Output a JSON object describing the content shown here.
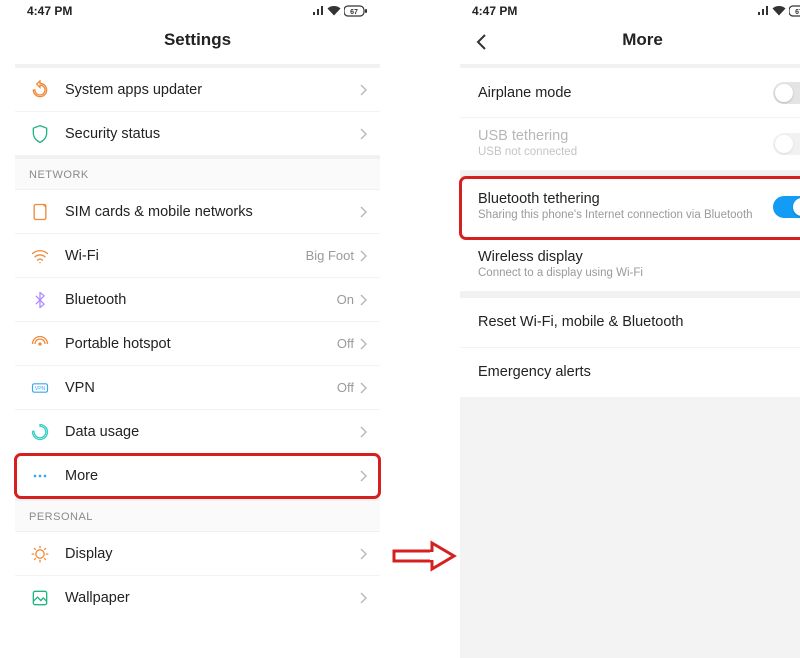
{
  "status": {
    "time": "4:47 PM",
    "battery": "67"
  },
  "left": {
    "title": "Settings",
    "items_top": [
      {
        "label": "System apps updater"
      },
      {
        "label": "Security status"
      }
    ],
    "section_network": "NETWORK",
    "items_network": [
      {
        "label": "SIM cards & mobile networks",
        "value": ""
      },
      {
        "label": "Wi-Fi",
        "value": "Big Foot"
      },
      {
        "label": "Bluetooth",
        "value": "On"
      },
      {
        "label": "Portable hotspot",
        "value": "Off"
      },
      {
        "label": "VPN",
        "value": "Off"
      },
      {
        "label": "Data usage",
        "value": ""
      },
      {
        "label": "More",
        "value": ""
      }
    ],
    "section_personal": "PERSONAL",
    "items_personal": [
      {
        "label": "Display"
      },
      {
        "label": "Wallpaper"
      }
    ]
  },
  "right": {
    "title": "More",
    "rows": [
      {
        "label": "Airplane mode",
        "sub": "",
        "toggle": "off"
      },
      {
        "label": "USB tethering",
        "sub": "USB not connected",
        "toggle": "off",
        "disabled": true
      },
      {
        "label": "Bluetooth tethering",
        "sub": "Sharing this phone's Internet connection via Bluetooth",
        "toggle": "on",
        "highlight": true
      },
      {
        "label": "Wireless display",
        "sub": "Connect to a display using Wi-Fi",
        "chevron": true
      },
      {
        "label": "Reset Wi-Fi, mobile & Bluetooth",
        "chevron": true
      },
      {
        "label": "Emergency alerts",
        "chevron": true
      }
    ]
  }
}
